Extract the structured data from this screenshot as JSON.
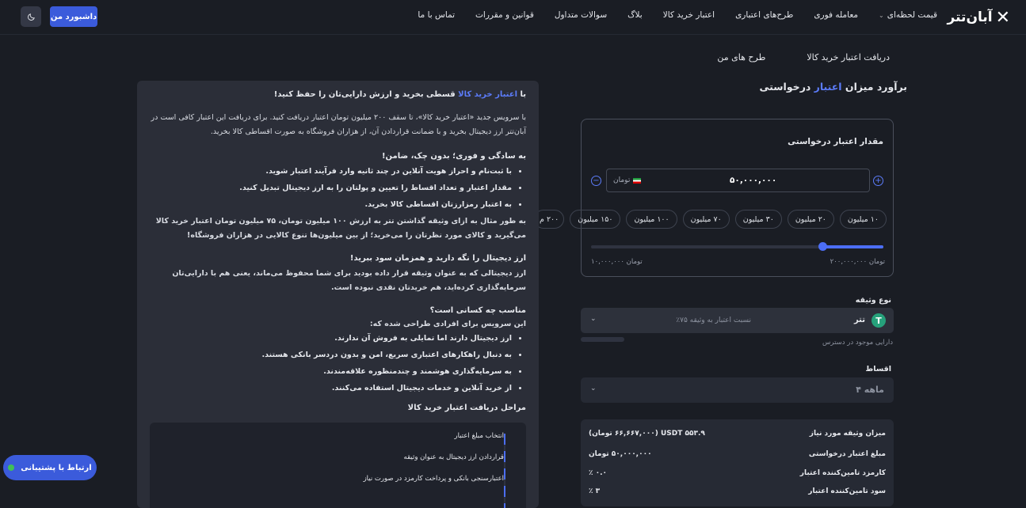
{
  "header": {
    "logo_text": "آبان‌تتر",
    "nav": [
      "قیمت لحظه‌ای",
      "معامله فوری",
      "طرح‌های اعتباری",
      "اعتبار خرید کالا",
      "بلاگ",
      "سوالات متداول",
      "قوانین و مقررات",
      "تماس با ما"
    ],
    "dashboard_label": "داشبورد من"
  },
  "tabs": [
    "دریافت اعتبار خرید کالا",
    "طرح های من"
  ],
  "calculator": {
    "title_pre": "برآورد میزان ",
    "title_acc": "اعتبار",
    "title_post": " درخواستی",
    "amount_label": "مقدار اعتبار درخواستی",
    "amount_value": "۵۰,۰۰۰,۰۰۰",
    "currency": "تومان",
    "chips": [
      "۱۰ میلیون",
      "۲۰ میلیون",
      "۳۰ میلیون",
      "۷۰ میلیون",
      "۱۰۰ میلیون",
      "۱۵۰ میلیون",
      "۲۰۰ م"
    ],
    "slider_fraction": 0.21,
    "range_max": "۲۰۰,۰۰۰,۰۰۰ تومان",
    "range_min": "۱۰,۰۰۰,۰۰۰ تومان",
    "collateral_label": "نوع وثیقه",
    "collateral_name": "تتر",
    "collateral_ratio": "نسبت اعتبار به وثیقه ۷۵٪",
    "available_label": "دارایی موجود در دسترس",
    "installments_label": "اقساط",
    "installments_value": "۴ ماهه",
    "summary": [
      {
        "k": "میزان وثیقه مورد نیاز",
        "v": "۵۵۳.۹ USDT  (۶۶,۶۶۷,۰۰۰ تومان)"
      },
      {
        "k": "مبلغ اعتبار درخواستی",
        "v": "۵۰,۰۰۰,۰۰۰ تومان"
      },
      {
        "k": "کارمزد تامین‌کننده اعتبار",
        "v": "۰.۰ ٪"
      },
      {
        "k": "سود تامین‌کننده اعتبار",
        "v": "۳ ٪"
      }
    ]
  },
  "info": {
    "h1_pre": "با ",
    "h1_acc": "اعتبار خرید کالا",
    "h1_post": " قسطی بخرید و ارزش دارایی‌تان را حفظ کنید!",
    "p1": "با سرویس جدید «اعتبار خرید کالا»، تا سقف ۲۰۰ میلیون تومان اعتبار دریافت کنید. برای دریافت این اعتبار کافی است در آبان‌تتر ارز دیجیتال بخرید و با ضمانت قراردادن آن، از هزاران فروشگاه به صورت اقساطی کالا بخرید.",
    "h2": "به سادگی و فوری؛ بدون چک، ضامن!",
    "list1": [
      "با ثبت‌نام و احراز هویت آنلاین در چند ثانیه وارد فرآیند اعتبار شوید.",
      "مقدار اعتبار و تعداد اقساط را تعیین و پولتان را به ارز دیجیتال تبدیل کنید.",
      "به اعتبار رمزارزتان اقساطی کالا بخرید."
    ],
    "p2": "به طور مثال به ازای وثیقه گذاشتن تتر به ارزش ۱۰۰ میلیون تومان، ۷۵ میلیون تومان اعتبار خرید کالا می‌گیرید و کالای مورد نظرتان را می‌خرید؛ از بین میلیون‌ها تنوع کالایی در هزاران فروشگاه!",
    "h3": "ارز دیجیتال را نگه دارید و همزمان سود ببرید!",
    "p3": "ارز دیجیتالی که به عنوان وثیقه قرار داده بودید برای شما محفوظ می‌ماند، یعنی هم با دارایی‌تان سرمایه‌گذاری کرده‌اید، هم خریدتان نقدی نبوده است.",
    "h4": "مناسب چه کسانی است؟",
    "p4": "این سرویس برای افرادی طراحی شده که:",
    "list2": [
      "ارز دیجیتال دارند اما تمایلی به فروش آن ندارند.",
      "به دنبال راهکارهای اعتباری سریع، امن و بدون دردسر بانکی هستند.",
      "به سرمایه‌گذاری هوشمند و چندمنظوره علاقه‌مندند.",
      "از خرید آنلاین و خدمات دیجیتال استفاده می‌کنند."
    ],
    "h5": "مراحل دریافت اعتبار خرید کالا",
    "steps": [
      "انتخاب مبلغ اعتبار",
      "قراردادن ارز دیجیتال به عنوان وثیقه",
      "اعتبارسنجی بانکی و پرداخت کارمزد در صورت نیاز"
    ]
  },
  "support_label": "ارتباط با پشتیبانی",
  "colors": {
    "accent": "#4c6ef5",
    "bg": "#1a1d24",
    "panel": "#2b2e38"
  }
}
